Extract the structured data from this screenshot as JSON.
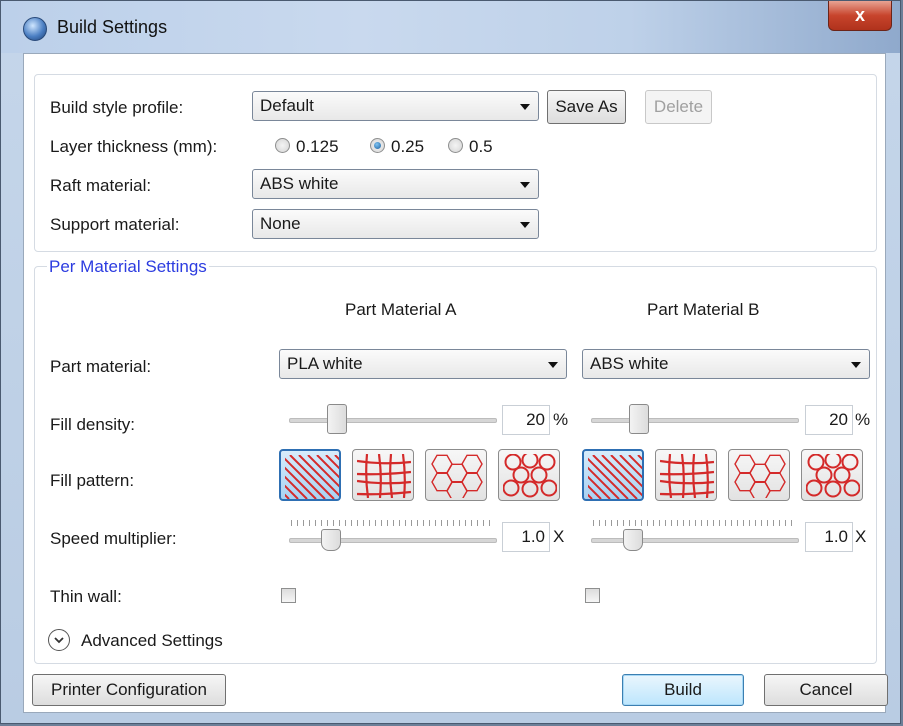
{
  "window": {
    "title": "Build Settings",
    "close_label": "x"
  },
  "top": {
    "build_style_label": "Build style profile:",
    "build_style_value": "Default",
    "save_as": "Save As",
    "delete": "Delete",
    "layer_label": "Layer thickness (mm):",
    "layer_options": [
      "0.125",
      "0.25",
      "0.5"
    ],
    "layer_selected": "0.25",
    "raft_label": "Raft material:",
    "raft_value": "ABS white",
    "support_label": "Support material:",
    "support_value": "None"
  },
  "per_material": {
    "legend": "Per Material Settings",
    "part_material_label": "Part material:",
    "fill_density_label": "Fill density:",
    "fill_pattern_label": "Fill pattern:",
    "speed_label": "Speed multiplier:",
    "thin_wall_label": "Thin wall:",
    "fill_patterns": [
      "diagonal-lines-icon",
      "grid-icon",
      "hexagon-icon",
      "circles-icon"
    ],
    "columns": [
      {
        "heading": "Part Material A",
        "material": "PLA white",
        "fill_density": "20",
        "fill_unit": "%",
        "fill_fraction": 0.2,
        "fill_pattern_selected": "diagonal-lines-icon",
        "speed": "1.0",
        "speed_unit": "X",
        "thin_wall": false
      },
      {
        "heading": "Part Material B",
        "material": "ABS white",
        "fill_density": "20",
        "fill_unit": "%",
        "fill_fraction": 0.2,
        "fill_pattern_selected": "diagonal-lines-icon",
        "speed": "1.0",
        "speed_unit": "X",
        "thin_wall": false
      }
    ],
    "advanced_settings": "Advanced Settings"
  },
  "footer": {
    "printer_config": "Printer Configuration",
    "build": "Build",
    "cancel": "Cancel"
  },
  "colors": {
    "legend_blue": "#2c3ce0",
    "pattern_red": "#d42a2a",
    "selected_blue": "#2e6fb3"
  }
}
